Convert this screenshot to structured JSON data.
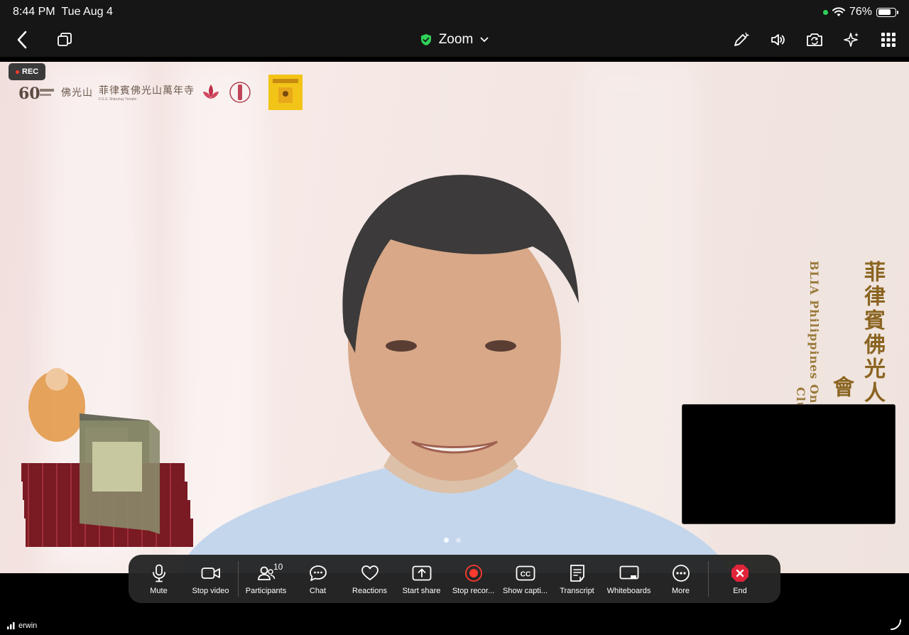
{
  "status_bar": {
    "time": "8:44 PM",
    "date": "Tue Aug 4",
    "battery": "76%",
    "battery_level": 0.76
  },
  "top_bar": {
    "meeting_title": "Zoom"
  },
  "stage": {
    "rec_label": "REC",
    "banner": {
      "logo_cjk_1": "佛光山",
      "logo_cjk_2": "菲律賓佛光山萬年寺",
      "logo_sub": "F.G.S. Mabuhay Temple"
    },
    "side_cjk": "菲律賓佛光人",
    "side_cjk_bottom": "會",
    "side_en": "BLIA Philippines Onlin",
    "side_en_bottom": "Club"
  },
  "toolbar": {
    "mute": "Mute",
    "stop_video": "Stop video",
    "participants": "Participants",
    "participants_count": "10",
    "chat": "Chat",
    "reactions": "Reactions",
    "start_share": "Start share",
    "stop_recording": "Stop recor...",
    "show_captions": "Show capti...",
    "transcript": "Transcript",
    "whiteboards": "Whiteboards",
    "more": "More",
    "end": "End"
  },
  "bottom": {
    "user_name": "erwin"
  },
  "colors": {
    "accent_green": "#2fd158",
    "record_red": "#ff3b30",
    "end_red": "#e0243a",
    "toolbar_bg": "#262626"
  }
}
